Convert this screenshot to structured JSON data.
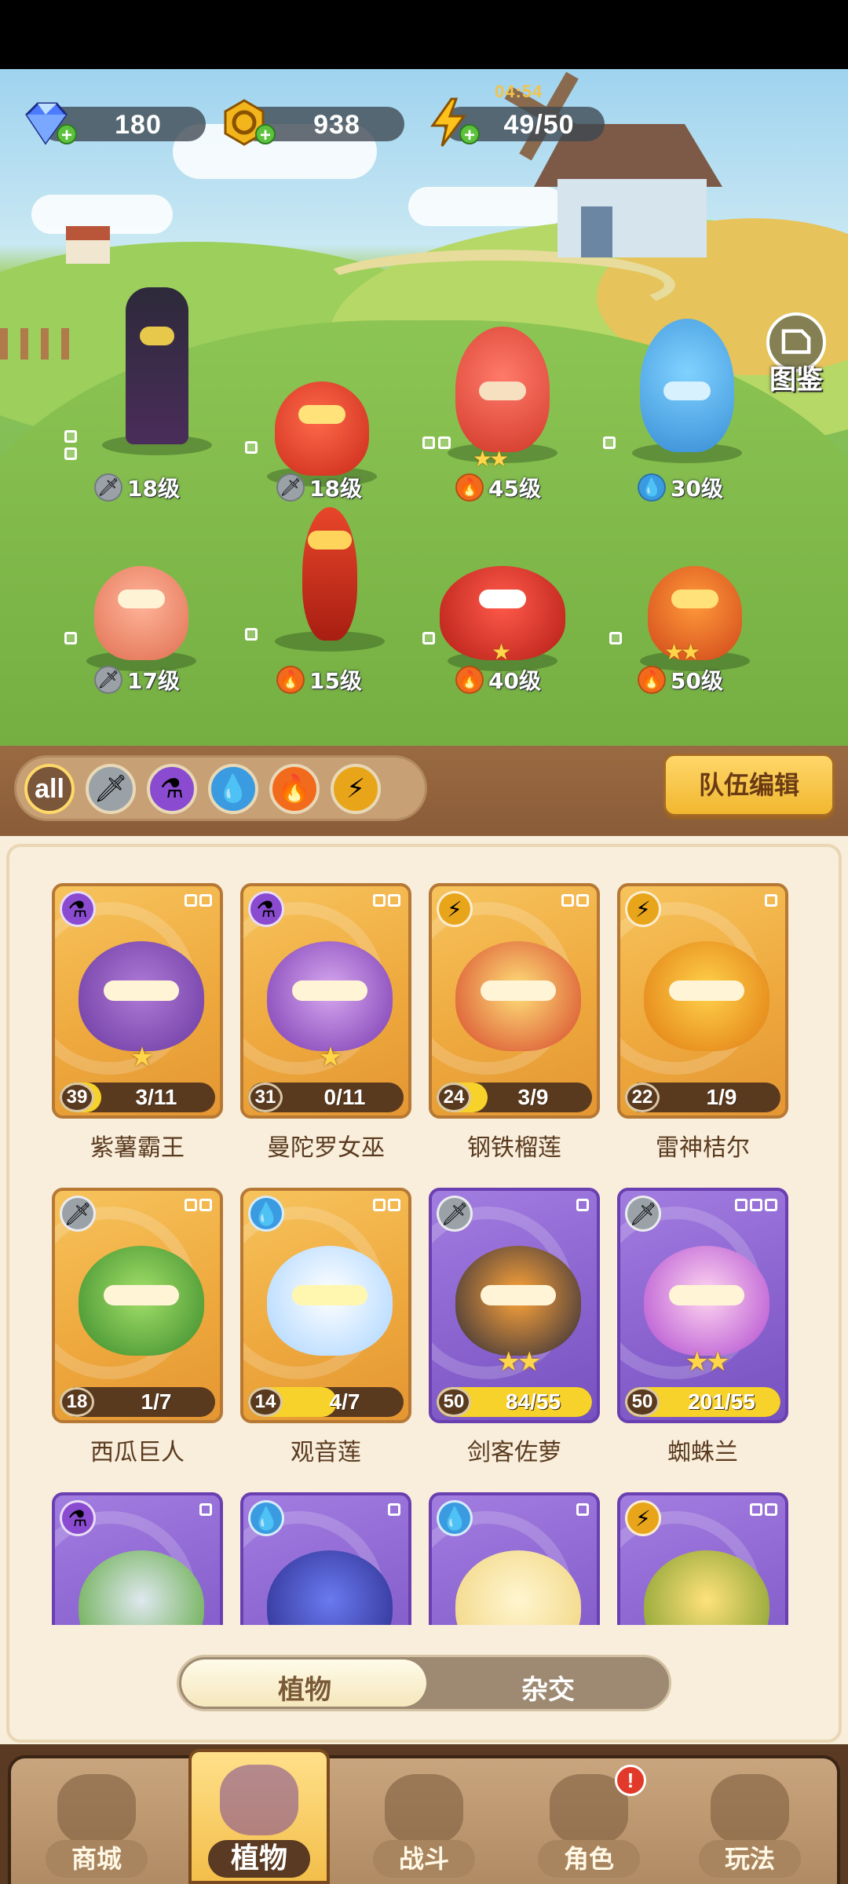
{
  "resources": {
    "diamonds": {
      "value": "180",
      "icon": "diamond-icon"
    },
    "coins": {
      "value": "938",
      "icon": "coin-icon"
    },
    "energy": {
      "value": "49/50",
      "icon": "lightning-icon",
      "timer": "04:54"
    }
  },
  "pokedex_label": "图鉴",
  "team": [
    {
      "level": "18级",
      "element": "sword",
      "stars": 0
    },
    {
      "level": "18级",
      "element": "sword",
      "stars": 0
    },
    {
      "level": "45级",
      "element": "fire",
      "stars": 2
    },
    {
      "level": "30级",
      "element": "water",
      "stars": 0
    },
    {
      "level": "17级",
      "element": "sword",
      "stars": 0
    },
    {
      "level": "15级",
      "element": "fire",
      "stars": 0
    },
    {
      "level": "40级",
      "element": "fire",
      "stars": 1
    },
    {
      "level": "50级",
      "element": "fire",
      "stars": 2
    }
  ],
  "filters": {
    "all_label": "all",
    "elements": [
      "sword",
      "poison",
      "water",
      "fire",
      "lightning"
    ]
  },
  "team_edit_label": "队伍编辑",
  "cards": [
    {
      "name": "紫薯霸王",
      "level": "39",
      "progress": "3/11",
      "fill": 0.27,
      "element": "poison",
      "rarity": "gold",
      "stars": 1
    },
    {
      "name": "曼陀罗女巫",
      "level": "31",
      "progress": "0/11",
      "fill": 0.0,
      "element": "poison",
      "rarity": "gold",
      "stars": 1
    },
    {
      "name": "钢铁榴莲",
      "level": "24",
      "progress": "3/9",
      "fill": 0.33,
      "element": "lightning",
      "rarity": "gold",
      "stars": 0
    },
    {
      "name": "雷神桔尔",
      "level": "22",
      "progress": "1/9",
      "fill": 0.11,
      "element": "lightning",
      "rarity": "gold",
      "stars": 0
    },
    {
      "name": "西瓜巨人",
      "level": "18",
      "progress": "1/7",
      "fill": 0.14,
      "element": "sword",
      "rarity": "gold",
      "stars": 0
    },
    {
      "name": "观音莲",
      "level": "14",
      "progress": "4/7",
      "fill": 0.57,
      "element": "water",
      "rarity": "gold",
      "stars": 0
    },
    {
      "name": "剑客佐萝",
      "level": "50",
      "progress": "84/55",
      "fill": 1.0,
      "element": "sword",
      "rarity": "purple",
      "stars": 2
    },
    {
      "name": "蜘蛛兰",
      "level": "50",
      "progress": "201/55",
      "fill": 1.0,
      "element": "sword",
      "rarity": "purple",
      "stars": 2
    },
    {
      "name": "",
      "level": "",
      "progress": "",
      "fill": 0,
      "element": "poison",
      "rarity": "purple",
      "stars": 0
    },
    {
      "name": "",
      "level": "",
      "progress": "",
      "fill": 0,
      "element": "water",
      "rarity": "purple",
      "stars": 0
    },
    {
      "name": "",
      "level": "",
      "progress": "",
      "fill": 0,
      "element": "water",
      "rarity": "purple",
      "stars": 0
    },
    {
      "name": "",
      "level": "",
      "progress": "",
      "fill": 0,
      "element": "lightning",
      "rarity": "purple",
      "stars": 0
    }
  ],
  "toggle": {
    "left": "植物",
    "right": "杂交",
    "selected": "left"
  },
  "nav": [
    {
      "label": "商城",
      "icon": "shop-icon"
    },
    {
      "label": "植物",
      "icon": "plants-icon",
      "active": true
    },
    {
      "label": "战斗",
      "icon": "battle-icon"
    },
    {
      "label": "角色",
      "icon": "character-icon",
      "badge": "!"
    },
    {
      "label": "玩法",
      "icon": "gameplay-icon"
    }
  ],
  "colors": {
    "sword": "#9aa2a8",
    "poison": "#8a4bd0",
    "water": "#3a9be0",
    "fire": "#f26a1b",
    "lightning": "#f0b21e",
    "gold_card": "#f1b042",
    "purple_card": "#8a63cf"
  }
}
